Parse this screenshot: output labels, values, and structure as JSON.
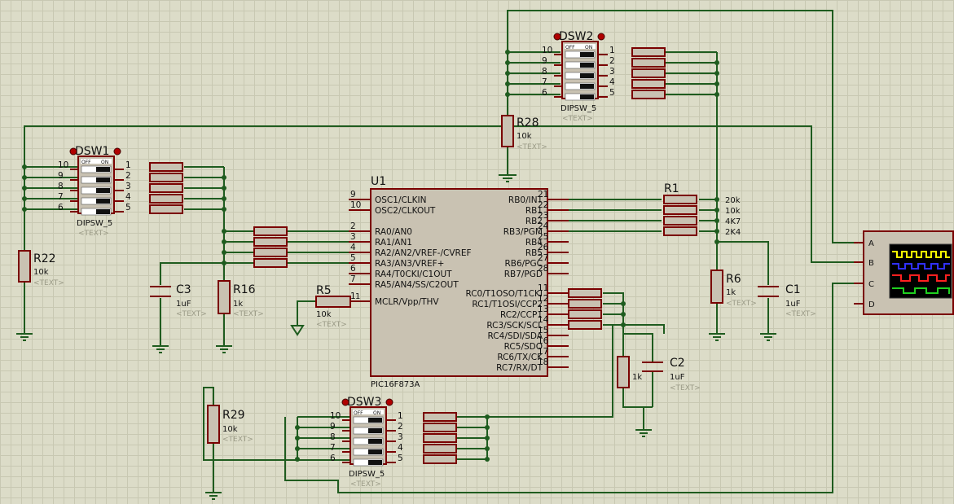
{
  "components": {
    "u1": {
      "ref": "U1",
      "part": "PIC16F873A"
    },
    "u1_left_pins": [
      {
        "num": "9",
        "name": "OSC1/CLKIN"
      },
      {
        "num": "10",
        "name": "OSC2/CLKOUT"
      },
      {
        "num": "2",
        "name": "RA0/AN0"
      },
      {
        "num": "3",
        "name": "RA1/AN1"
      },
      {
        "num": "4",
        "name": "RA2/AN2/VREF-/CVREF"
      },
      {
        "num": "5",
        "name": "RA3/AN3/VREF+"
      },
      {
        "num": "6",
        "name": "RA4/T0CKI/C1OUT"
      },
      {
        "num": "7",
        "name": "RA5/AN4/SS/C2OUT"
      },
      {
        "num": "1",
        "name": "MCLR/Vpp/THV"
      }
    ],
    "u1_right_pins": [
      {
        "num": "21",
        "name": "RB0/INT"
      },
      {
        "num": "22",
        "name": "RB1"
      },
      {
        "num": "23",
        "name": "RB2"
      },
      {
        "num": "24",
        "name": "RB3/PGM"
      },
      {
        "num": "25",
        "name": "RB4"
      },
      {
        "num": "26",
        "name": "RB5"
      },
      {
        "num": "27",
        "name": "RB6/PGC"
      },
      {
        "num": "28",
        "name": "RB7/PGD"
      },
      {
        "num": "11",
        "name": "RC0/T1OSO/T1CKI"
      },
      {
        "num": "12",
        "name": "RC1/T1OSI/CCP2"
      },
      {
        "num": "13",
        "name": "RC2/CCP1"
      },
      {
        "num": "14",
        "name": "RC3/SCK/SCL"
      },
      {
        "num": "15",
        "name": "RC4/SDI/SDA"
      },
      {
        "num": "16",
        "name": "RC5/SDO"
      },
      {
        "num": "17",
        "name": "RC6/TX/CK"
      },
      {
        "num": "18",
        "name": "RC7/RX/DT"
      }
    ],
    "dsw1": {
      "ref": "DSW1",
      "part": "DIPSW_5",
      "text": "<TEXT>"
    },
    "dsw2": {
      "ref": "DSW2",
      "part": "DIPSW_5",
      "text": "<TEXT>"
    },
    "dsw3": {
      "ref": "DSW3",
      "part": "DIPSW_5",
      "text": "<TEXT>"
    },
    "dip_left_nums": [
      "10",
      "9",
      "8",
      "7",
      "6"
    ],
    "dip_right_nums": [
      "1",
      "2",
      "3",
      "4",
      "5"
    ],
    "dip_off": "OFF",
    "dip_on": "ON",
    "r1": {
      "ref": "R1",
      "values": [
        "20k",
        "10k",
        "4K7",
        "2K4"
      ]
    },
    "r5": {
      "ref": "R5",
      "value": "10k",
      "text": "<TEXT>",
      "pin": "1"
    },
    "r6": {
      "ref": "R6",
      "value": "1k",
      "text": "<TEXT>"
    },
    "r16": {
      "ref": "R16",
      "value": "1k",
      "text": "<TEXT>"
    },
    "r22": {
      "ref": "R22",
      "value": "10k",
      "text": "<TEXT>"
    },
    "r28": {
      "ref": "R28",
      "value": "10k",
      "text": "<TEXT>"
    },
    "r29": {
      "ref": "R29",
      "value": "10k",
      "text": "<TEXT>"
    },
    "r_rc": {
      "value": "1k"
    },
    "c1": {
      "ref": "C1",
      "value": "1uF",
      "text": "<TEXT>"
    },
    "c2": {
      "ref": "C2",
      "value": "1uF",
      "text": "<TEXT>"
    },
    "c3": {
      "ref": "C3",
      "value": "1uF",
      "text": "<TEXT>"
    },
    "scope": {
      "channels": [
        "A",
        "B",
        "C",
        "D"
      ]
    }
  },
  "colors": {
    "wire": "#1f5c1f",
    "component": "#7a0000",
    "fill": "#c9c2b2",
    "channel_a": "#ffff00",
    "channel_b": "#3030ff",
    "channel_c": "#ff2020",
    "channel_d": "#20d020"
  }
}
